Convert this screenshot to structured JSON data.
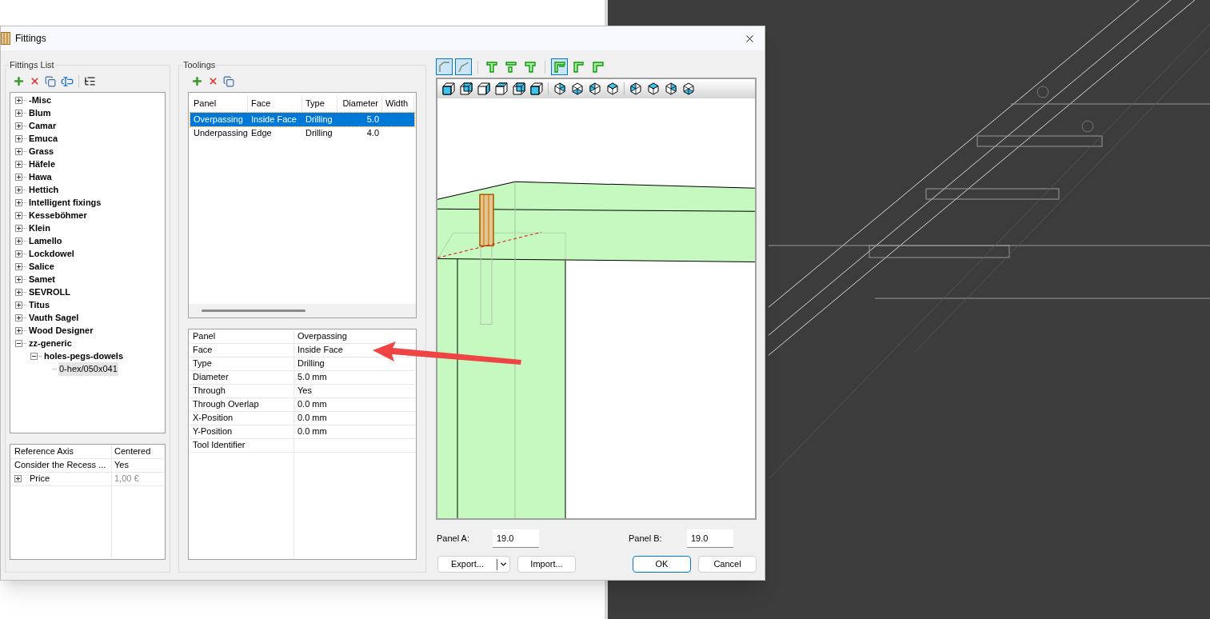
{
  "window": {
    "title": "Fittings"
  },
  "fittings_list": {
    "title": "Fittings List",
    "tree": [
      {
        "label": "-Misc",
        "expanded": false,
        "selected": false
      },
      {
        "label": "Blum",
        "expanded": false,
        "selected": false
      },
      {
        "label": "Camar",
        "expanded": false,
        "selected": false
      },
      {
        "label": "Emuca",
        "expanded": false,
        "selected": false
      },
      {
        "label": "Grass",
        "expanded": false,
        "selected": false
      },
      {
        "label": "Häfele",
        "expanded": false,
        "selected": false
      },
      {
        "label": "Hawa",
        "expanded": false,
        "selected": false
      },
      {
        "label": "Hettich",
        "expanded": false,
        "selected": false
      },
      {
        "label": "Intelligent fixings",
        "expanded": false,
        "selected": false
      },
      {
        "label": "Kesseböhmer",
        "expanded": false,
        "selected": false
      },
      {
        "label": "Klein",
        "expanded": false,
        "selected": false
      },
      {
        "label": "Lamello",
        "expanded": false,
        "selected": false
      },
      {
        "label": "Lockdowel",
        "expanded": false,
        "selected": false
      },
      {
        "label": "Salice",
        "expanded": false,
        "selected": false
      },
      {
        "label": "Samet",
        "expanded": false,
        "selected": false
      },
      {
        "label": "SEVROLL",
        "expanded": false,
        "selected": false
      },
      {
        "label": "Titus",
        "expanded": false,
        "selected": false
      },
      {
        "label": "Vauth Sagel",
        "expanded": false,
        "selected": false
      },
      {
        "label": "Wood Designer",
        "expanded": false,
        "selected": false
      },
      {
        "label": "zz-generic",
        "expanded": true,
        "selected": false,
        "children": [
          {
            "label": "holes-pegs-dowels",
            "expanded": true,
            "selected": false,
            "children": [
              {
                "label": "0-hex/050x041",
                "selected": true
              }
            ]
          }
        ]
      }
    ],
    "properties": [
      {
        "name": "Reference Axis",
        "value": "Centered",
        "kind": "plain",
        "disabled": false
      },
      {
        "name": "Consider the Recess ...",
        "value": "Yes",
        "kind": "plain",
        "disabled": false
      },
      {
        "name": "Price",
        "value": "1,00 €",
        "kind": "group",
        "expanded": false,
        "disabled": true
      }
    ]
  },
  "toolings": {
    "title": "Toolings",
    "columns": [
      "Panel",
      "Face",
      "Type",
      "Diameter",
      "Width"
    ],
    "rows": [
      {
        "cells": [
          "Overpassing",
          "Inside Face",
          "Drilling",
          "5.0"
        ],
        "selected": true
      },
      {
        "cells": [
          "Underpassing",
          "Edge",
          "Drilling",
          "4.0"
        ],
        "selected": false
      }
    ],
    "details": [
      {
        "name": "Panel",
        "value": "Overpassing"
      },
      {
        "name": "Face",
        "value": "Inside Face"
      },
      {
        "name": "Type",
        "value": "Drilling"
      },
      {
        "name": "Diameter",
        "value": "5.0 mm"
      },
      {
        "name": "Through",
        "value": "Yes"
      },
      {
        "name": "Through Overlap",
        "value": "0.0 mm"
      },
      {
        "name": "X-Position",
        "value": "0.0 mm"
      },
      {
        "name": "Y-Position",
        "value": "0.0 mm"
      },
      {
        "name": "Tool Identifier"
      }
    ]
  },
  "preview": {
    "toolbar": [
      [
        {
          "selected": true
        },
        {
          "selected": true
        }
      ],
      [
        {
          "selected": false
        },
        {
          "selected": false
        },
        {
          "selected": false
        }
      ],
      [
        {
          "selected": true
        },
        {
          "selected": false
        },
        {
          "selected": false
        }
      ]
    ],
    "panel_a": {
      "label": "Panel A:",
      "value": "19.0"
    },
    "panel_b": {
      "label": "Panel B:",
      "value": "19.0"
    }
  },
  "buttons": [
    {
      "label": "Export...",
      "kind": "split"
    },
    {
      "label": "Import...",
      "kind": "plain"
    },
    {
      "label": "OK",
      "kind": "default"
    },
    {
      "label": "Cancel",
      "kind": "plain"
    }
  ]
}
